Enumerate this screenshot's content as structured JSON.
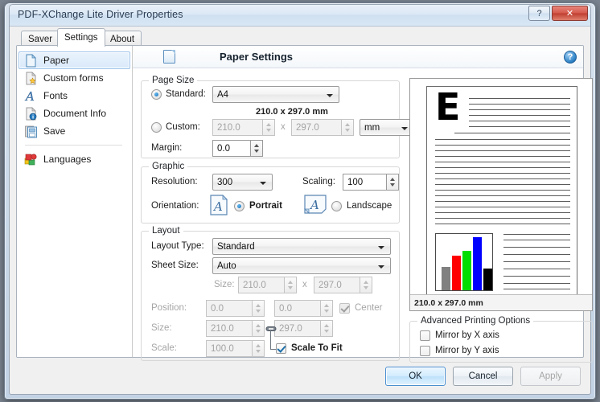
{
  "window": {
    "title": "PDF-XChange Lite Driver Properties",
    "help_button": "?",
    "close_button": "✕"
  },
  "tabs": [
    {
      "label": "Saver",
      "active": false
    },
    {
      "label": "Settings",
      "active": true
    },
    {
      "label": "About",
      "active": false
    }
  ],
  "sidebar": {
    "items": [
      {
        "label": "Paper",
        "icon": "page-icon",
        "selected": true
      },
      {
        "label": "Custom forms",
        "icon": "page-star-icon",
        "selected": false
      },
      {
        "label": "Fonts",
        "icon": "font-a-icon",
        "selected": false
      },
      {
        "label": "Document Info",
        "icon": "page-info-icon",
        "selected": false
      },
      {
        "label": "Save",
        "icon": "save-icon",
        "selected": false
      },
      {
        "label": "Languages",
        "icon": "languages-icon",
        "selected": false
      }
    ]
  },
  "header": {
    "title": "Paper Settings",
    "icon": "page-icon",
    "help": "?"
  },
  "page_size": {
    "group_title": "Page Size",
    "standard_label": "Standard:",
    "standard_selected": true,
    "standard_value": "A4",
    "dimension_text": "210.0 x 297.0 mm",
    "custom_label": "Custom:",
    "custom_selected": false,
    "custom_width": "210.0",
    "custom_x": "x",
    "custom_height": "297.0",
    "units_value": "mm",
    "margin_label": "Margin:",
    "margin_value": "0.0"
  },
  "graphic": {
    "group_title": "Graphic",
    "resolution_label": "Resolution:",
    "resolution_value": "300",
    "scaling_label": "Scaling:",
    "scaling_value": "100",
    "orientation_label": "Orientation:",
    "portrait_label": "Portrait",
    "portrait_selected": true,
    "landscape_label": "Landscape",
    "landscape_selected": false,
    "orientation_icon_letter": "A"
  },
  "layout": {
    "group_title": "Layout",
    "layout_type_label": "Layout Type:",
    "layout_type_value": "Standard",
    "sheet_size_label": "Sheet Size:",
    "sheet_size_value": "Auto",
    "size_row_label": "Size:",
    "size_row_width": "210.0",
    "size_row_x": "x",
    "size_row_height": "297.0",
    "position_label": "Position:",
    "position_x": "0.0",
    "position_y": "0.0",
    "center_label": "Center",
    "center_checked": true,
    "size_label": "Size:",
    "size_width": "210.0",
    "size_height": "297.0",
    "scale_label": "Scale:",
    "scale_value": "100.0",
    "scale_to_fit_label": "Scale To Fit",
    "scale_to_fit_checked": true,
    "link_icon": "chain-link-icon"
  },
  "preview": {
    "letter": "E",
    "dimension_label": "210.0 x 297.0 mm",
    "chart": {
      "bars": [
        {
          "color": "#808080",
          "height_pct": 42
        },
        {
          "color": "#ff0000",
          "height_pct": 62
        },
        {
          "color": "#00dd00",
          "height_pct": 70
        },
        {
          "color": "#0000ff",
          "height_pct": 95
        },
        {
          "color": "#000000",
          "height_pct": 38
        }
      ]
    }
  },
  "advanced": {
    "group_title": "Advanced Printing Options",
    "mirror_x_label": "Mirror by X axis",
    "mirror_x_checked": false,
    "mirror_y_label": "Mirror by Y axis",
    "mirror_y_checked": false
  },
  "buttons": {
    "ok": "OK",
    "cancel": "Cancel",
    "apply": "Apply"
  }
}
